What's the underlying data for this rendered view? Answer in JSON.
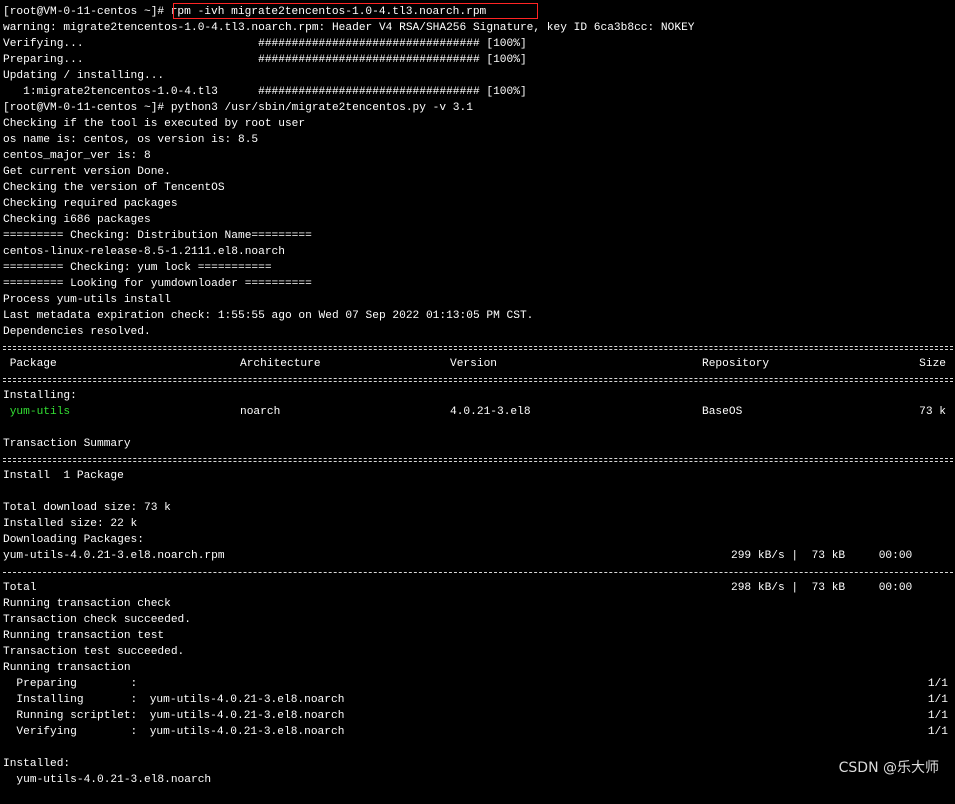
{
  "terminal": {
    "l01": "[root@VM-0-11-centos ~]#",
    "l01_cmd": " rpm -ivh migrate2tencentos-1.0-4.tl3.noarch.rpm",
    "l02": "warning: migrate2tencentos-1.0-4.tl3.noarch.rpm: Header V4 RSA/SHA256 Signature, key ID 6ca3b8cc: NOKEY",
    "l03": "Verifying...                          ################################# [100%]",
    "l04": "Preparing...                          ################################# [100%]",
    "l05": "Updating / installing...",
    "l06": "   1:migrate2tencentos-1.0-4.tl3      ################################# [100%]",
    "l07": "[root@VM-0-11-centos ~]# python3 /usr/sbin/migrate2tencentos.py -v 3.1",
    "l08": "Checking if the tool is executed by root user",
    "l09": "os name is: centos, os version is: 8.5",
    "l10": "centos_major_ver is: 8",
    "l11": "Get current version Done.",
    "l12": "Checking the version of TencentOS",
    "l13": "Checking required packages",
    "l14": "Checking i686 packages",
    "l15": "========= Checking: Distribution Name=========",
    "l16": "centos-linux-release-8.5-1.2111.el8.noarch",
    "l17": "========= Checking: yum lock ===========",
    "l18": "========= Looking for yumdownloader ==========",
    "l19": "Process yum-utils install",
    "l20": "Last metadata expiration check: 1:55:55 ago on Wed 07 Sep 2022 01:13:05 PM CST.",
    "l21": "Dependencies resolved.",
    "table_header": {
      "package": " Package",
      "architecture": "Architecture",
      "version": "Version",
      "repository": "Repository",
      "size": "Size"
    },
    "installing_label": "Installing:",
    "package_row": {
      "name": " yum-utils",
      "arch": "noarch",
      "version": "4.0.21-3.el8",
      "repo": "BaseOS",
      "size": "73 k"
    },
    "transaction_summary": "Transaction Summary",
    "install_count": "Install  1 Package",
    "total_download": "Total download size: 73 k",
    "installed_size": "Installed size: 22 k",
    "downloading": "Downloading Packages:",
    "download_row": {
      "file": "yum-utils-4.0.21-3.el8.noarch.rpm",
      "speed": "299 kB/s |  73 kB     00:00"
    },
    "total_row": {
      "label": "Total",
      "speed": "298 kB/s |  73 kB     00:00"
    },
    "run_check": "Running transaction check",
    "check_ok": "Transaction check succeeded.",
    "run_test": "Running transaction test",
    "test_ok": "Transaction test succeeded.",
    "run_tx": "Running transaction",
    "steps": [
      {
        "label": "  Preparing        :",
        "pkg": "",
        "count": "1/1"
      },
      {
        "label": "  Installing       :",
        "pkg": " yum-utils-4.0.21-3.el8.noarch",
        "count": "1/1"
      },
      {
        "label": "  Running scriptlet:",
        "pkg": " yum-utils-4.0.21-3.el8.noarch",
        "count": "1/1"
      },
      {
        "label": "  Verifying        :",
        "pkg": " yum-utils-4.0.21-3.el8.noarch",
        "count": "1/1"
      }
    ],
    "installed_label": "Installed:",
    "installed_pkg": "  yum-utils-4.0.21-3.el8.noarch"
  },
  "watermark": "CSDN @乐大师",
  "colors": {
    "background": "#000000",
    "text": "#ffffff",
    "highlight_package": "#33e033",
    "command_box": "#ff2424"
  }
}
